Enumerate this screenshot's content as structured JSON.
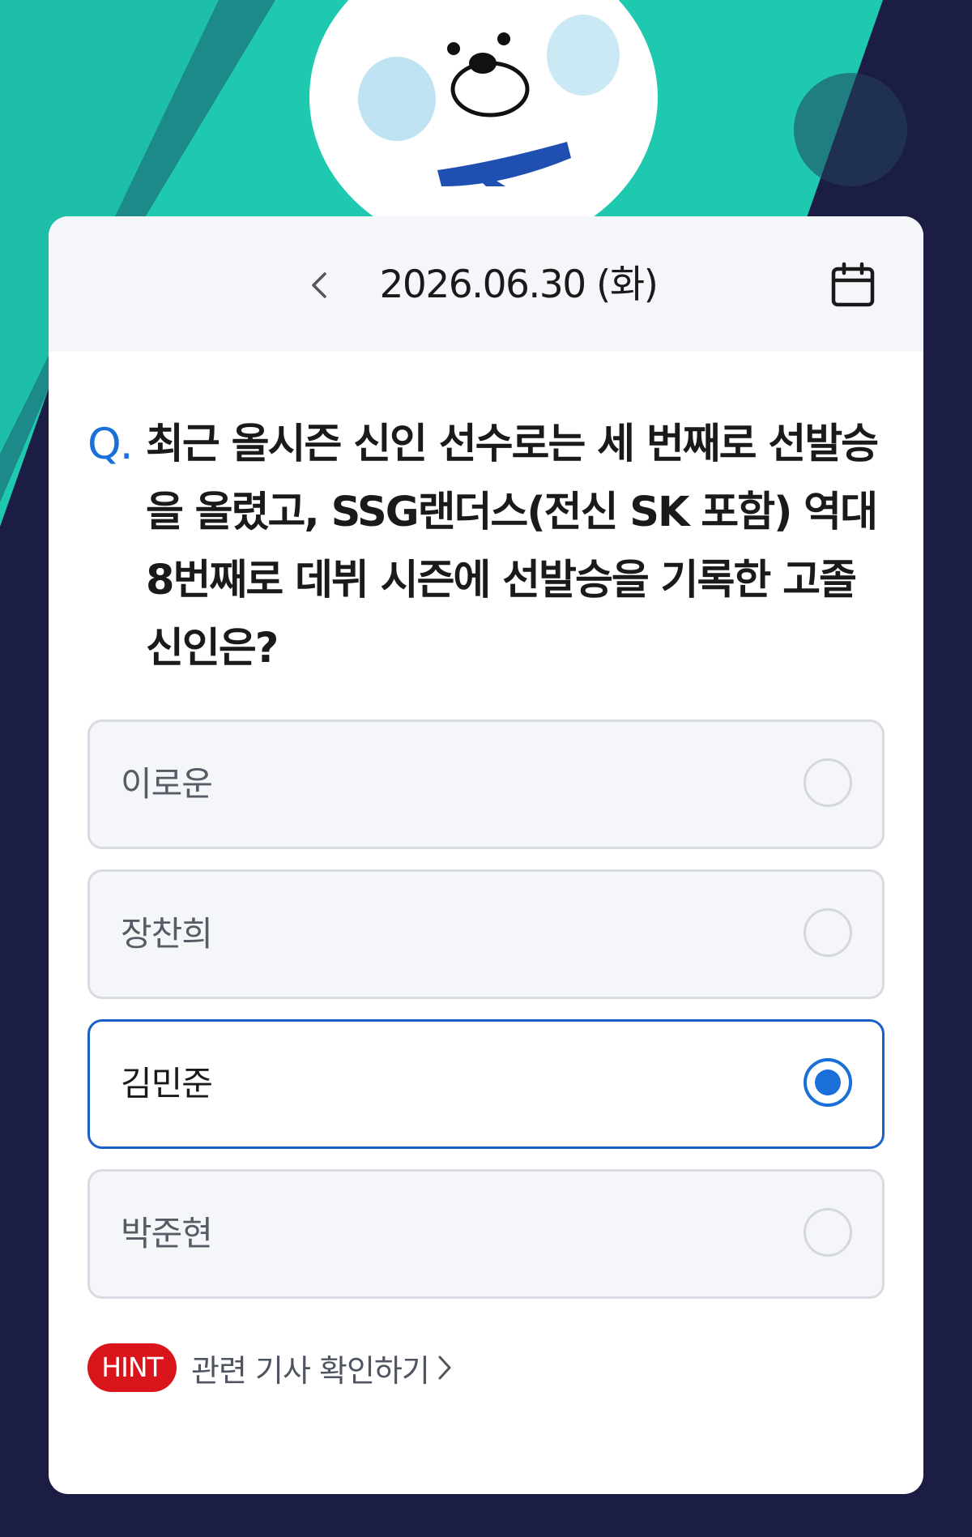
{
  "header": {
    "date": "2026.06.30 (화)"
  },
  "quiz": {
    "q_mark": "Q.",
    "question": "최근 올시즌 신인 선수로는 세 번째로 선발승을 올렸고, SSG랜더스(전신 SK 포함) 역대 8번째로 데뷔 시즌에 선발승을 기록한 고졸 신인은?",
    "options": [
      {
        "label": "이로운",
        "selected": false
      },
      {
        "label": "장찬희",
        "selected": false
      },
      {
        "label": "김민준",
        "selected": true
      },
      {
        "label": "박준현",
        "selected": false
      }
    ]
  },
  "hint": {
    "badge": "HINT",
    "link_text": "관련 기사 확인하기"
  },
  "colors": {
    "accent": "#1a6fd8",
    "hint_red": "#d9141b",
    "background_navy": "#1b1d45",
    "background_teal": "#1ec9b0"
  },
  "icons": [
    "chevron-left-icon",
    "calendar-icon",
    "chevron-right-icon"
  ]
}
